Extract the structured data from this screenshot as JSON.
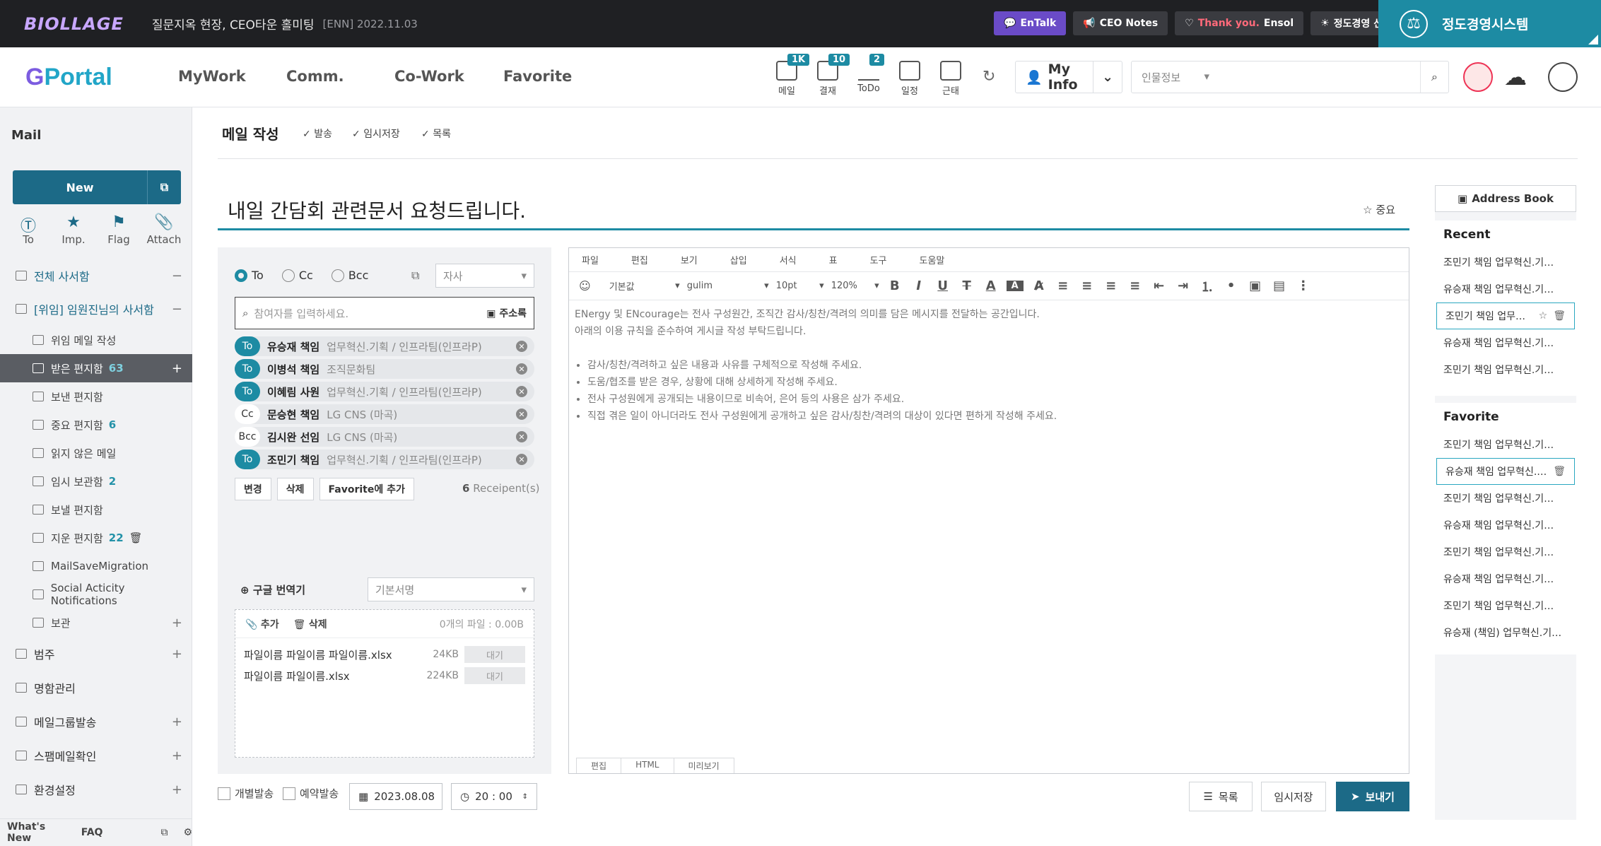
{
  "topbar": {
    "logo_text": "BIOLLAGE",
    "notice": "질문지옥 현장, CEO타운 홀미팅",
    "notice_date": "[ENN] 2022.11.03",
    "buttons": [
      {
        "label": "EnTalk",
        "icon": "chat-icon"
      },
      {
        "label": "CEO Notes",
        "icon": "megaphone-icon"
      },
      {
        "label_a": "Thank you.",
        "label_b": "Ensol",
        "icon": "heart-icon"
      },
      {
        "label": "정도경영 신고센터",
        "icon": "sun-icon"
      }
    ],
    "ethics_title": "정도경영시스템"
  },
  "gnb": {
    "logo": "Portal",
    "menus": [
      "MyWork",
      "Comm.",
      "Co-Work",
      "Favorite"
    ],
    "quick": [
      {
        "label": "메일",
        "badge": "1K"
      },
      {
        "label": "결재",
        "badge": "10"
      },
      {
        "label": "ToDo",
        "badge": "2"
      },
      {
        "label": "일정",
        "badge": ""
      },
      {
        "label": "근태",
        "badge": ""
      }
    ],
    "myinfo": "My Info",
    "search_select": "인물정보",
    "search_placeholder": ""
  },
  "sidebar": {
    "title": "Mail",
    "new_label": "New",
    "quick": [
      "To",
      "Imp.",
      "Flag",
      "Attach"
    ],
    "folders": [
      {
        "label": "전체 사서함",
        "count": "",
        "pm": "−"
      },
      {
        "label": "[위임] 임원진님의 사서함",
        "count": "",
        "pm": "−"
      },
      {
        "label": "위임 메일 작성",
        "count": "",
        "pm": ""
      },
      {
        "label": "받은 편지함",
        "count": "63",
        "pm": "+"
      },
      {
        "label": "보낸 편지함",
        "count": "",
        "pm": ""
      },
      {
        "label": "중요 편지함",
        "count": "6",
        "pm": ""
      },
      {
        "label": "읽지 않은 메일",
        "count": "",
        "pm": ""
      },
      {
        "label": "임시 보관함",
        "count": "2",
        "pm": ""
      },
      {
        "label": "보낼 편지함",
        "count": "",
        "pm": ""
      },
      {
        "label": "지운 편지함",
        "count": "22",
        "pm": ""
      },
      {
        "label": "MailSaveMigration",
        "count": "",
        "pm": ""
      },
      {
        "label": "Social Acticity Notifications",
        "count": "",
        "pm": ""
      },
      {
        "label": "보관",
        "count": "",
        "pm": "+"
      },
      {
        "label": "범주",
        "count": "",
        "pm": "+"
      },
      {
        "label": "명함관리",
        "count": "",
        "pm": ""
      },
      {
        "label": "메일그룹발송",
        "count": "",
        "pm": "+"
      },
      {
        "label": "스팸메일확인",
        "count": "",
        "pm": "+"
      },
      {
        "label": "환경설정",
        "count": "",
        "pm": "+"
      }
    ],
    "footer": [
      "What's New",
      "FAQ"
    ]
  },
  "compose": {
    "page_title": "메일 작성",
    "actions": [
      "발송",
      "임시저장",
      "목록"
    ],
    "subject": "내일 간담회 관련문서 요청드립니다.",
    "important": "중요",
    "radio": [
      "To",
      "Cc",
      "Bcc"
    ],
    "company_select": "자사",
    "recipient_placeholder": "참여자를 입력하세요.",
    "address_btn": "주소록",
    "recipients": [
      {
        "tag": "To",
        "name": "유승재 책임",
        "org": "업무혁신.기획 / 인프라팀(인프라P)"
      },
      {
        "tag": "To",
        "name": "이병석 책임",
        "org": "조직문화팀"
      },
      {
        "tag": "To",
        "name": "이혜림 사원",
        "org": "업무혁신.기획 / 인프라팀(인프라P)"
      },
      {
        "tag": "Cc",
        "name": "문승현 책임",
        "org": "LG CNS (마곡)"
      },
      {
        "tag": "Bcc",
        "name": "김시완 선임",
        "org": "LG CNS (마곡)"
      },
      {
        "tag": "To",
        "name": "조민기 책임",
        "org": "업무혁신.기획 / 인프라팀(인프라P)"
      }
    ],
    "rbtns": [
      "변경",
      "삭제",
      "Favorite에 추가"
    ],
    "rcount_num": "6",
    "rcount_text": "Receipent(s)",
    "translator": "구글 번역기",
    "signature": "기본서명",
    "att_add": "추가",
    "att_del": "삭제",
    "att_info": "0개의 파일 : 0.00B",
    "attachments": [
      {
        "name": "파일이름 파일이름 파일이름.xlsx",
        "size": "24KB",
        "status": "대기"
      },
      {
        "name": "파일이름 파일이름.xlsx",
        "size": "224KB",
        "status": "대기"
      }
    ]
  },
  "editor": {
    "menu": [
      "파일",
      "편집",
      "보기",
      "삽입",
      "서식",
      "표",
      "도구",
      "도움말"
    ],
    "style": "기본값",
    "font": "gulim",
    "size": "10pt",
    "zoom": "120%",
    "line1": "ENergy 및 ENcourage는 전사 구성원간, 조직간 감사/칭찬/격려의 의미를 담은 메시지를 전달하는 공간입니다.",
    "line2": "아래의 이용 규칙을 준수하여 게시글 작성 부탁드립니다.",
    "bullets": [
      "감사/칭찬/격려하고 싶은 내용과 사유를 구체적으로 작성해 주세요.",
      "도움/협조를 받은 경우, 상황에 대해 상세하게 작성해 주세요.",
      "전사 구성원에게 공개되는 내용이므로 비속어, 은어 등의 사용은 삼가 주세요.",
      "직접 겪은 일이 아니더라도 전사 구성원에게 공개하고 싶은 감사/칭찬/격려의 대상이 있다면 편하게 작성해 주세요."
    ],
    "tabs": [
      "편집",
      "HTML",
      "미리보기"
    ]
  },
  "bottom": {
    "individual": "개별발송",
    "reserve": "예약발송",
    "date": "2023.08.08",
    "time": "20 : 00",
    "list_btn": "목록",
    "draft_btn": "임시저장",
    "send_btn": "보내기"
  },
  "right": {
    "address_book": "Address Book",
    "recent_title": "Recent",
    "recent": [
      "조민기 책임 업무혁신.기…",
      "유승재 책임 업무혁신.기…",
      "조민기 책임 업무…",
      "유승재 책임 업무혁신.기…",
      "조민기 책임 업무혁신.기…"
    ],
    "favorite_title": "Favorite",
    "favorite": [
      "조민기 책임 업무혁신.기…",
      "유승재 책임 업무혁신.…",
      "조민기 책임 업무혁신.기…",
      "유승재 책임 업무혁신.기…",
      "조민기 책임 업무혁신.기…",
      "유승재 책임 업무혁신.기…",
      "조민기 책임 업무혁신.기…",
      "유승재 (책임) 업무혁신.기…"
    ]
  }
}
